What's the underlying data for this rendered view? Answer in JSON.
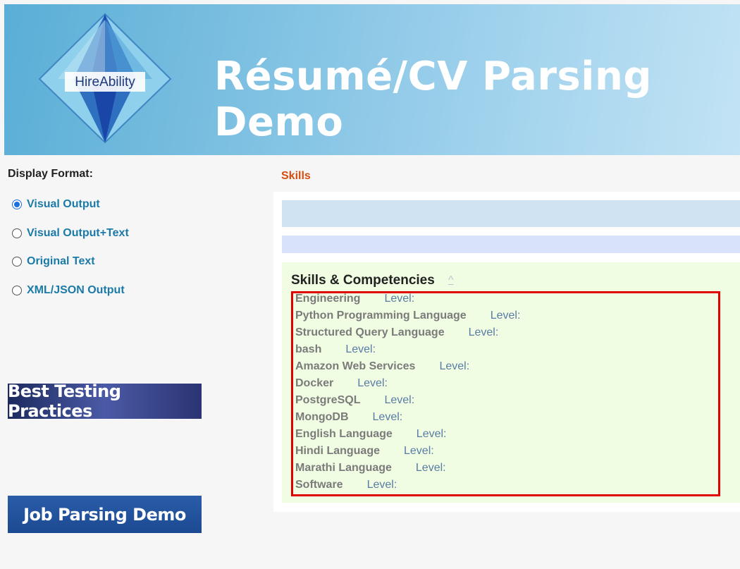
{
  "header": {
    "logo_text": "HireAbility",
    "title": "Résumé/CV Parsing Demo"
  },
  "display_format": {
    "label": "Display Format:",
    "options": [
      {
        "label": "Visual Output",
        "checked": true
      },
      {
        "label": "Visual Output+Text",
        "checked": false
      },
      {
        "label": "Original Text",
        "checked": false
      },
      {
        "label": "XML/JSON Output",
        "checked": false
      }
    ]
  },
  "promos": {
    "best_testing": "Best Testing Practices",
    "job_parsing": "Job Parsing Demo"
  },
  "section": {
    "title": "Skills",
    "heading": "Skills & Competencies",
    "caret": "^",
    "level_label": "Level:",
    "skills": [
      "Engineering",
      "Python Programming Language",
      "Structured Query Language",
      "bash",
      "Amazon Web Services",
      "Docker",
      "PostgreSQL",
      "MongoDB",
      "English Language",
      "Hindi Language",
      "Marathi Language",
      "Software"
    ]
  },
  "colors": {
    "accent_orange": "#d54e10",
    "link_blue": "#1b7aa8",
    "highlight_red": "#e00000"
  }
}
